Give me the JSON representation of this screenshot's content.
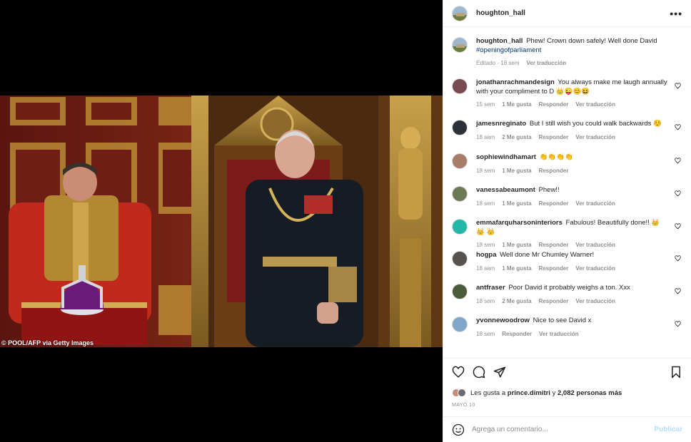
{
  "post": {
    "author": "houghton_hall",
    "photo_credit": "© POOL/AFP via Getty Images",
    "caption_text": "Phew! Crown down safely! Well done David",
    "caption_hashtag": "#openingofparliament",
    "caption_edited": "Editado · 18 sem",
    "caption_translate": "Ver traducción"
  },
  "comments": [
    {
      "user": "jonathanrachmandesign",
      "text": "You always make me laugh annually with your compliment to D 👑😜😊😆",
      "age": "15 sem",
      "likes": "1 Me gusta",
      "reply": "Responder",
      "translate": "Ver traducción",
      "avatar_color": "#7a4a52"
    },
    {
      "user": "jamesnreginato",
      "text": "But I still wish you could walk backwards ☺️",
      "age": "18 sem",
      "likes": "2 Me gusta",
      "reply": "Responder",
      "translate": "Ver traducción",
      "avatar_color": "#2d3038"
    },
    {
      "user": "sophiewindhamart",
      "text": "👏👏👏👏",
      "age": "18 sem",
      "likes": "1 Me gusta",
      "reply": "Responder",
      "translate": "",
      "avatar_color": "#a77c68"
    },
    {
      "user": "vanessabeaumont",
      "text": "Phew!!",
      "age": "18 sem",
      "likes": "1 Me gusta",
      "reply": "Responder",
      "translate": "Ver traducción",
      "avatar_color": "#6c7a55"
    },
    {
      "user": "emmafarquharsoninteriors",
      "text": "Fabulous! Beautifully done!! 👑 👑 👑",
      "age": "18 sem",
      "likes": "1 Me gusta",
      "reply": "Responder",
      "translate": "Ver traducción",
      "avatar_color": "#23b7a8"
    },
    {
      "user": "hogpa",
      "text": "Well done Mr Chumley Warner!",
      "age": "18 sem",
      "likes": "1 Me gusta",
      "reply": "Responder",
      "translate": "Ver traducción",
      "avatar_color": "#55524f"
    },
    {
      "user": "antfraser",
      "text": "Poor David it probably weighs a ton. Xxx",
      "age": "18 sem",
      "likes": "2 Me gusta",
      "reply": "Responder",
      "translate": "Ver traducción",
      "avatar_color": "#4b5a3a"
    },
    {
      "user": "yvonnewoodrow",
      "text": "Nice to see David x",
      "age": "18 sem",
      "likes": "",
      "reply": "Responder",
      "translate": "Ver traducción",
      "avatar_color": "#7fa7c9"
    }
  ],
  "likes_line": {
    "prefix": "Les gusta a",
    "user": "prince.dimitri",
    "joiner": "y",
    "count": "2,082 personas más"
  },
  "post_date": "MAYO 10",
  "comment_box": {
    "placeholder": "Agrega un comentario...",
    "publish_label": "Publicar"
  },
  "icons": [
    "more-icon",
    "heart-icon",
    "comment-icon",
    "share-icon",
    "bookmark-icon",
    "emoji-icon"
  ]
}
